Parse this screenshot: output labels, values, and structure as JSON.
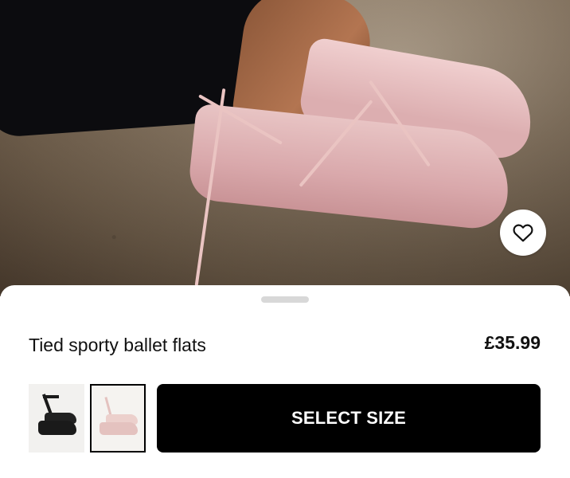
{
  "product": {
    "name": "Tied sporty ballet flats",
    "price": "£35.99"
  },
  "actions": {
    "select_size_label": "SELECT SIZE"
  },
  "icons": {
    "wishlist": "heart-icon"
  },
  "variants": [
    {
      "color": "black",
      "selected": false
    },
    {
      "color": "pink",
      "selected": true
    }
  ],
  "colors": {
    "button_bg": "#000000",
    "button_text": "#ffffff",
    "selected_border": "#000000"
  }
}
